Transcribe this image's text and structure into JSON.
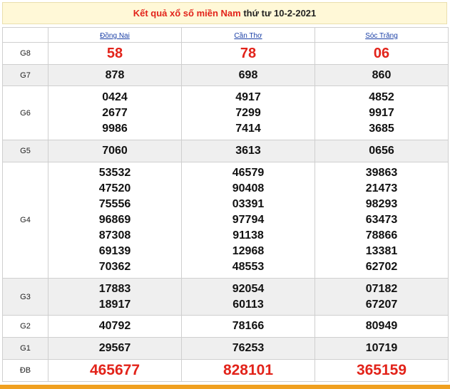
{
  "title": {
    "prefix": "Kết quả xổ số miền Nam",
    "date": "thứ tư 10-2-2021"
  },
  "provinces": [
    "Đồng Nai",
    "Cần Thơ",
    "Sóc Trăng"
  ],
  "rows": [
    {
      "label": "G8",
      "values": [
        "58",
        "78",
        "06"
      ]
    },
    {
      "label": "G7",
      "values": [
        "878",
        "698",
        "860"
      ]
    },
    {
      "label": "G6",
      "values": [
        "0424\n2677\n9986",
        "4917\n7299\n7414",
        "4852\n9917\n3685"
      ]
    },
    {
      "label": "G5",
      "values": [
        "7060",
        "3613",
        "0656"
      ]
    },
    {
      "label": "G4",
      "values": [
        "53532\n47520\n75556\n96869\n87308\n69139\n70362",
        "46579\n90408\n03391\n97794\n91138\n12968\n48553",
        "39863\n21473\n98293\n63473\n78866\n13381\n62702"
      ]
    },
    {
      "label": "G3",
      "values": [
        "17883\n18917",
        "92054\n60113",
        "07182\n67207"
      ]
    },
    {
      "label": "G2",
      "values": [
        "40792",
        "78166",
        "80949"
      ]
    },
    {
      "label": "G1",
      "values": [
        "29567",
        "76253",
        "10719"
      ]
    },
    {
      "label": "ĐB",
      "values": [
        "465677",
        "828101",
        "365159"
      ]
    }
  ],
  "colors": {
    "accent": "#e2231a",
    "link": "#1a3fa6",
    "header_bg": "#fff8d7",
    "alt_row_bg": "#efefef"
  }
}
